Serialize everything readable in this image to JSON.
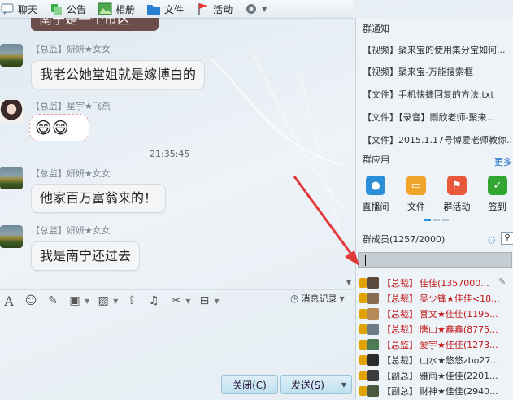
{
  "toolbar": {
    "items": [
      {
        "label": "聊天",
        "icon": "chat-icon"
      },
      {
        "label": "公告",
        "icon": "announcement-icon"
      },
      {
        "label": "相册",
        "icon": "album-icon"
      },
      {
        "label": "文件",
        "icon": "folder-icon"
      },
      {
        "label": "活动",
        "icon": "flag-icon"
      },
      {
        "label": "",
        "icon": "gear-icon"
      }
    ]
  },
  "chat": {
    "partial_text": "南宁是一个市区",
    "messages": [
      {
        "sender": "【总监】妍妍★女女",
        "text": "我老公她堂姐就是嫁博白的"
      },
      {
        "sender": "【总监】星宇★飞燕",
        "emoji": "😄😄"
      },
      {
        "time": "21:35:45"
      },
      {
        "sender": "【总监】妍妍★女女",
        "text": "他家百万富翁来的！"
      },
      {
        "sender": "【总监】妍妍★女女",
        "text": "我是南宁还过去"
      }
    ]
  },
  "input_toolbar": {
    "record_label": "消息记录"
  },
  "buttons": {
    "close": "关闭(C)",
    "send": "发送(S)"
  },
  "group_notice": {
    "title": "群通知",
    "items": [
      "【视频】聚来宝的使用集分宝如何...",
      "【视频】聚来宝-万能搜索框",
      "【文件】手机快捷回复的方法.txt",
      "【文件】【录音】雨欣老师-聚来...",
      "【文件】2015.1.17号博爱老师教你..."
    ]
  },
  "group_apps": {
    "title": "群应用",
    "more": "更多",
    "apps": [
      {
        "label": "直播间",
        "color": "#2a8fd6"
      },
      {
        "label": "文件",
        "color": "#f0a52a"
      },
      {
        "label": "群活动",
        "color": "#e8583b"
      },
      {
        "label": "签到",
        "color": "#33a532"
      }
    ]
  },
  "members": {
    "title": "群成员(1257/2000)",
    "list": [
      {
        "title": "【总裁】",
        "name": "佳佳(1357000..."
      },
      {
        "title": "【总裁】",
        "name": "吴少锋★佳佳<18..."
      },
      {
        "title": "【总裁】",
        "name": "喜文★佳佳(1195..."
      },
      {
        "title": "【总裁】",
        "name": "唐山★鑫鑫(8775..."
      },
      {
        "title": "【总监】",
        "name": "爱宇★佳佳(1273..."
      },
      {
        "title": "【总裁】",
        "name": "山水★悠悠zbo27..."
      },
      {
        "title": "【副总】",
        "name": "雅雨★佳佳(2201..."
      },
      {
        "title": "【副总】",
        "name": "财神★佳佳(2940..."
      }
    ]
  },
  "colors": {
    "accent": "#c0191b",
    "arrow": "#e23a3a",
    "button": "#bfe0ef"
  }
}
